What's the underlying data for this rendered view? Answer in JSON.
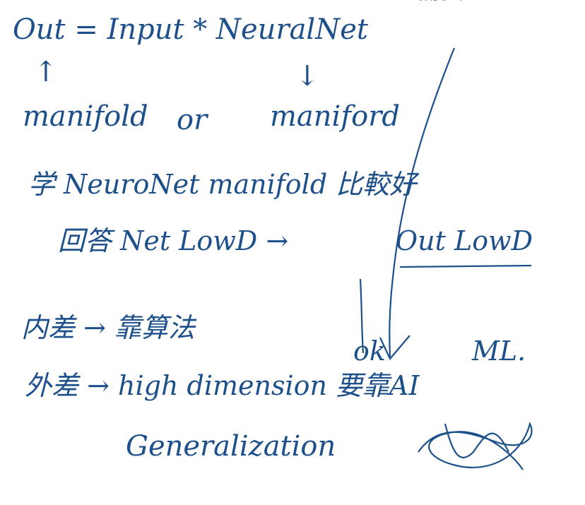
{
  "ink_color": "#1d4f8a",
  "notes": {
    "top_partial": "需要",
    "line1": "Out = Input * NeuralNet",
    "arrow_up": "↑",
    "arrow_down": "↓",
    "manifold_left": "manifold",
    "or": "or",
    "manifold_right": "maniford",
    "line4": "学 NeuroNet manifold 比較好",
    "line5_left": "回答 Net LowD →",
    "line5_right": "Out LowD",
    "line6": "内差 → 靠算法",
    "ok": "ok",
    "ml": "ML.",
    "line7": "外差 → high dimension 要靠AI",
    "line8": "Generalization"
  }
}
